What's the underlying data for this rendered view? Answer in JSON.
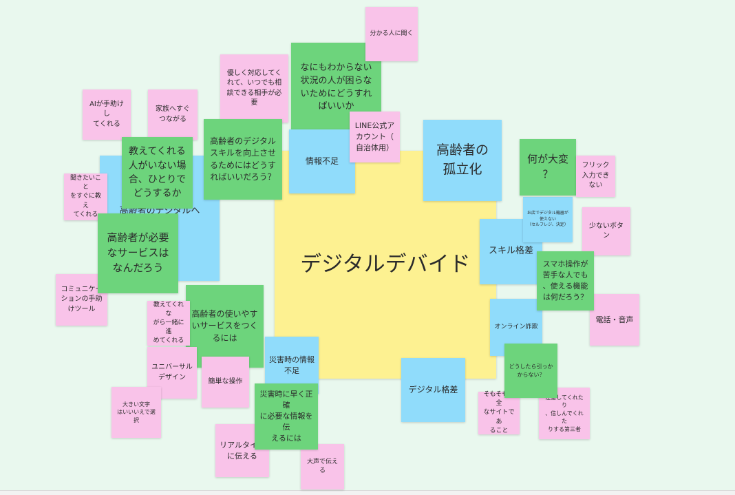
{
  "board": {
    "center_note": "デジタルデバイド",
    "notes": [
      {
        "id": "n01",
        "color": "pink",
        "text": "分かる人に聞く"
      },
      {
        "id": "n02",
        "color": "green",
        "text": "なにもわからない\n状況の人が困らな\nいためにどうすれ\nばいいか"
      },
      {
        "id": "n03",
        "color": "pink",
        "text": "優しく対応してく\nれて、いつでも相\n談できる相手が必\n要"
      },
      {
        "id": "n04",
        "color": "pink",
        "text": "AIが手助けし\nてくれる"
      },
      {
        "id": "n05",
        "color": "pink",
        "text": "家族へすぐ\nつながる"
      },
      {
        "id": "n06",
        "color": "blue",
        "text": "高齢者のデジタルへ\nの不足"
      },
      {
        "id": "n07",
        "color": "green",
        "text": "教えてくれる\n人がいない場\n合、ひとりで\nどうするか"
      },
      {
        "id": "n08",
        "color": "green",
        "text": "高齢者のデジタル\nスキルを向上させ\nるためにはどうす\nればいいだろう？"
      },
      {
        "id": "n09",
        "color": "blue",
        "text": "情報不足"
      },
      {
        "id": "n10",
        "color": "pink",
        "text": "LINE公式ア\nカウント（\n自治体用）"
      },
      {
        "id": "n11",
        "color": "blue",
        "text": "高齢者の\n孤立化"
      },
      {
        "id": "n12",
        "color": "green",
        "text": "何が大変\n？"
      },
      {
        "id": "n13",
        "color": "pink",
        "text": "フリック\n入力でき\nない"
      },
      {
        "id": "n14",
        "color": "pink",
        "text": "聞きたいこと\nをすぐに教え\nてくれる"
      },
      {
        "id": "n15",
        "color": "blue",
        "text": "お店でデジタル機器が\n使えない\n（セルフレジ、決定）"
      },
      {
        "id": "n16",
        "color": "pink",
        "text": "少ないボタン"
      },
      {
        "id": "n17",
        "color": "green",
        "text": "高齢者が必要\nなサービスは\nなんだろう"
      },
      {
        "id": "n18",
        "color": "blue",
        "text": "スキル格差"
      },
      {
        "id": "n19",
        "color": "green",
        "text": "スマホ操作が\n苦手な人でも\n、使える機能\nは何だろう？"
      },
      {
        "id": "n20",
        "color": "pink",
        "text": "コミュニケー\nションの手助\nけツール"
      },
      {
        "id": "n21",
        "color": "green",
        "text": "高齢者の使いやす\nいサービスをつく\nるには"
      },
      {
        "id": "n22",
        "color": "pink",
        "text": "教えてくれな\nがら一緒に進\nめてくれる"
      },
      {
        "id": "n23",
        "color": "blue",
        "text": "オンライン詐欺"
      },
      {
        "id": "n24",
        "color": "pink",
        "text": "電話・音声"
      },
      {
        "id": "n25",
        "color": "blue",
        "text": "災害時の情報\n不足"
      },
      {
        "id": "n26",
        "color": "pink",
        "text": "ユニバーサル\nデザイン"
      },
      {
        "id": "n27",
        "color": "pink",
        "text": "簡単な操作"
      },
      {
        "id": "n28",
        "color": "green",
        "text": "どうしたら引っか\nからない？"
      },
      {
        "id": "n29",
        "color": "blue",
        "text": "デジタル格差"
      },
      {
        "id": "n30",
        "color": "pink",
        "text": "大きい文字\nはいいいえで選択"
      },
      {
        "id": "n31",
        "color": "green",
        "text": "災害時に早く正確\nに必要な情報を伝\nえるには"
      },
      {
        "id": "n32",
        "color": "pink",
        "text": "そもそも安全\nなサイトであ\nること"
      },
      {
        "id": "n33",
        "color": "pink",
        "text": "注意してくれたり\n、信しんでくれた\nりする第三者"
      },
      {
        "id": "n34",
        "color": "pink",
        "text": "リアルタイム\nに伝える"
      },
      {
        "id": "n35",
        "color": "pink",
        "text": "大声で伝える"
      }
    ]
  }
}
